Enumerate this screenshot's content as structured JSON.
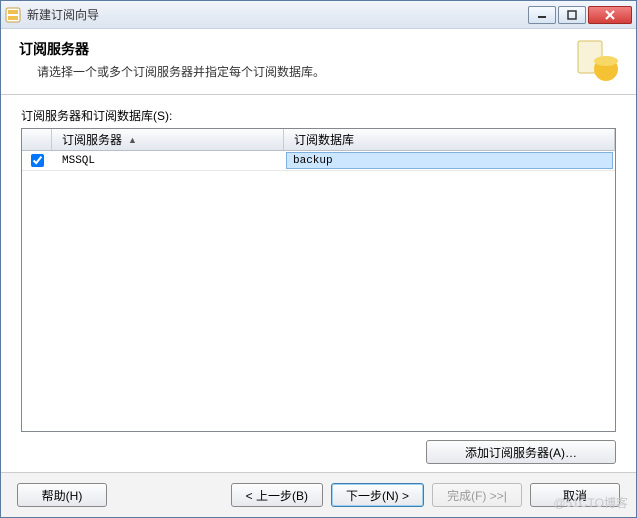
{
  "window": {
    "title": "新建订阅向导"
  },
  "banner": {
    "heading": "订阅服务器",
    "subtitle": "请选择一个或多个订阅服务器并指定每个订阅数据库。"
  },
  "table": {
    "label": "订阅服务器和订阅数据库(S):",
    "headers": {
      "col1": "订阅服务器",
      "col2": "订阅数据库"
    },
    "rows": [
      {
        "checked": true,
        "server": "MSSQL",
        "database": "backup"
      }
    ]
  },
  "buttons": {
    "add_server": "添加订阅服务器(A)…",
    "help": "帮助(H)",
    "back": "< 上一步(B)",
    "next": "下一步(N) >",
    "finish": "完成(F) >>|",
    "cancel": "取消"
  },
  "watermark": "@51CTO博客"
}
